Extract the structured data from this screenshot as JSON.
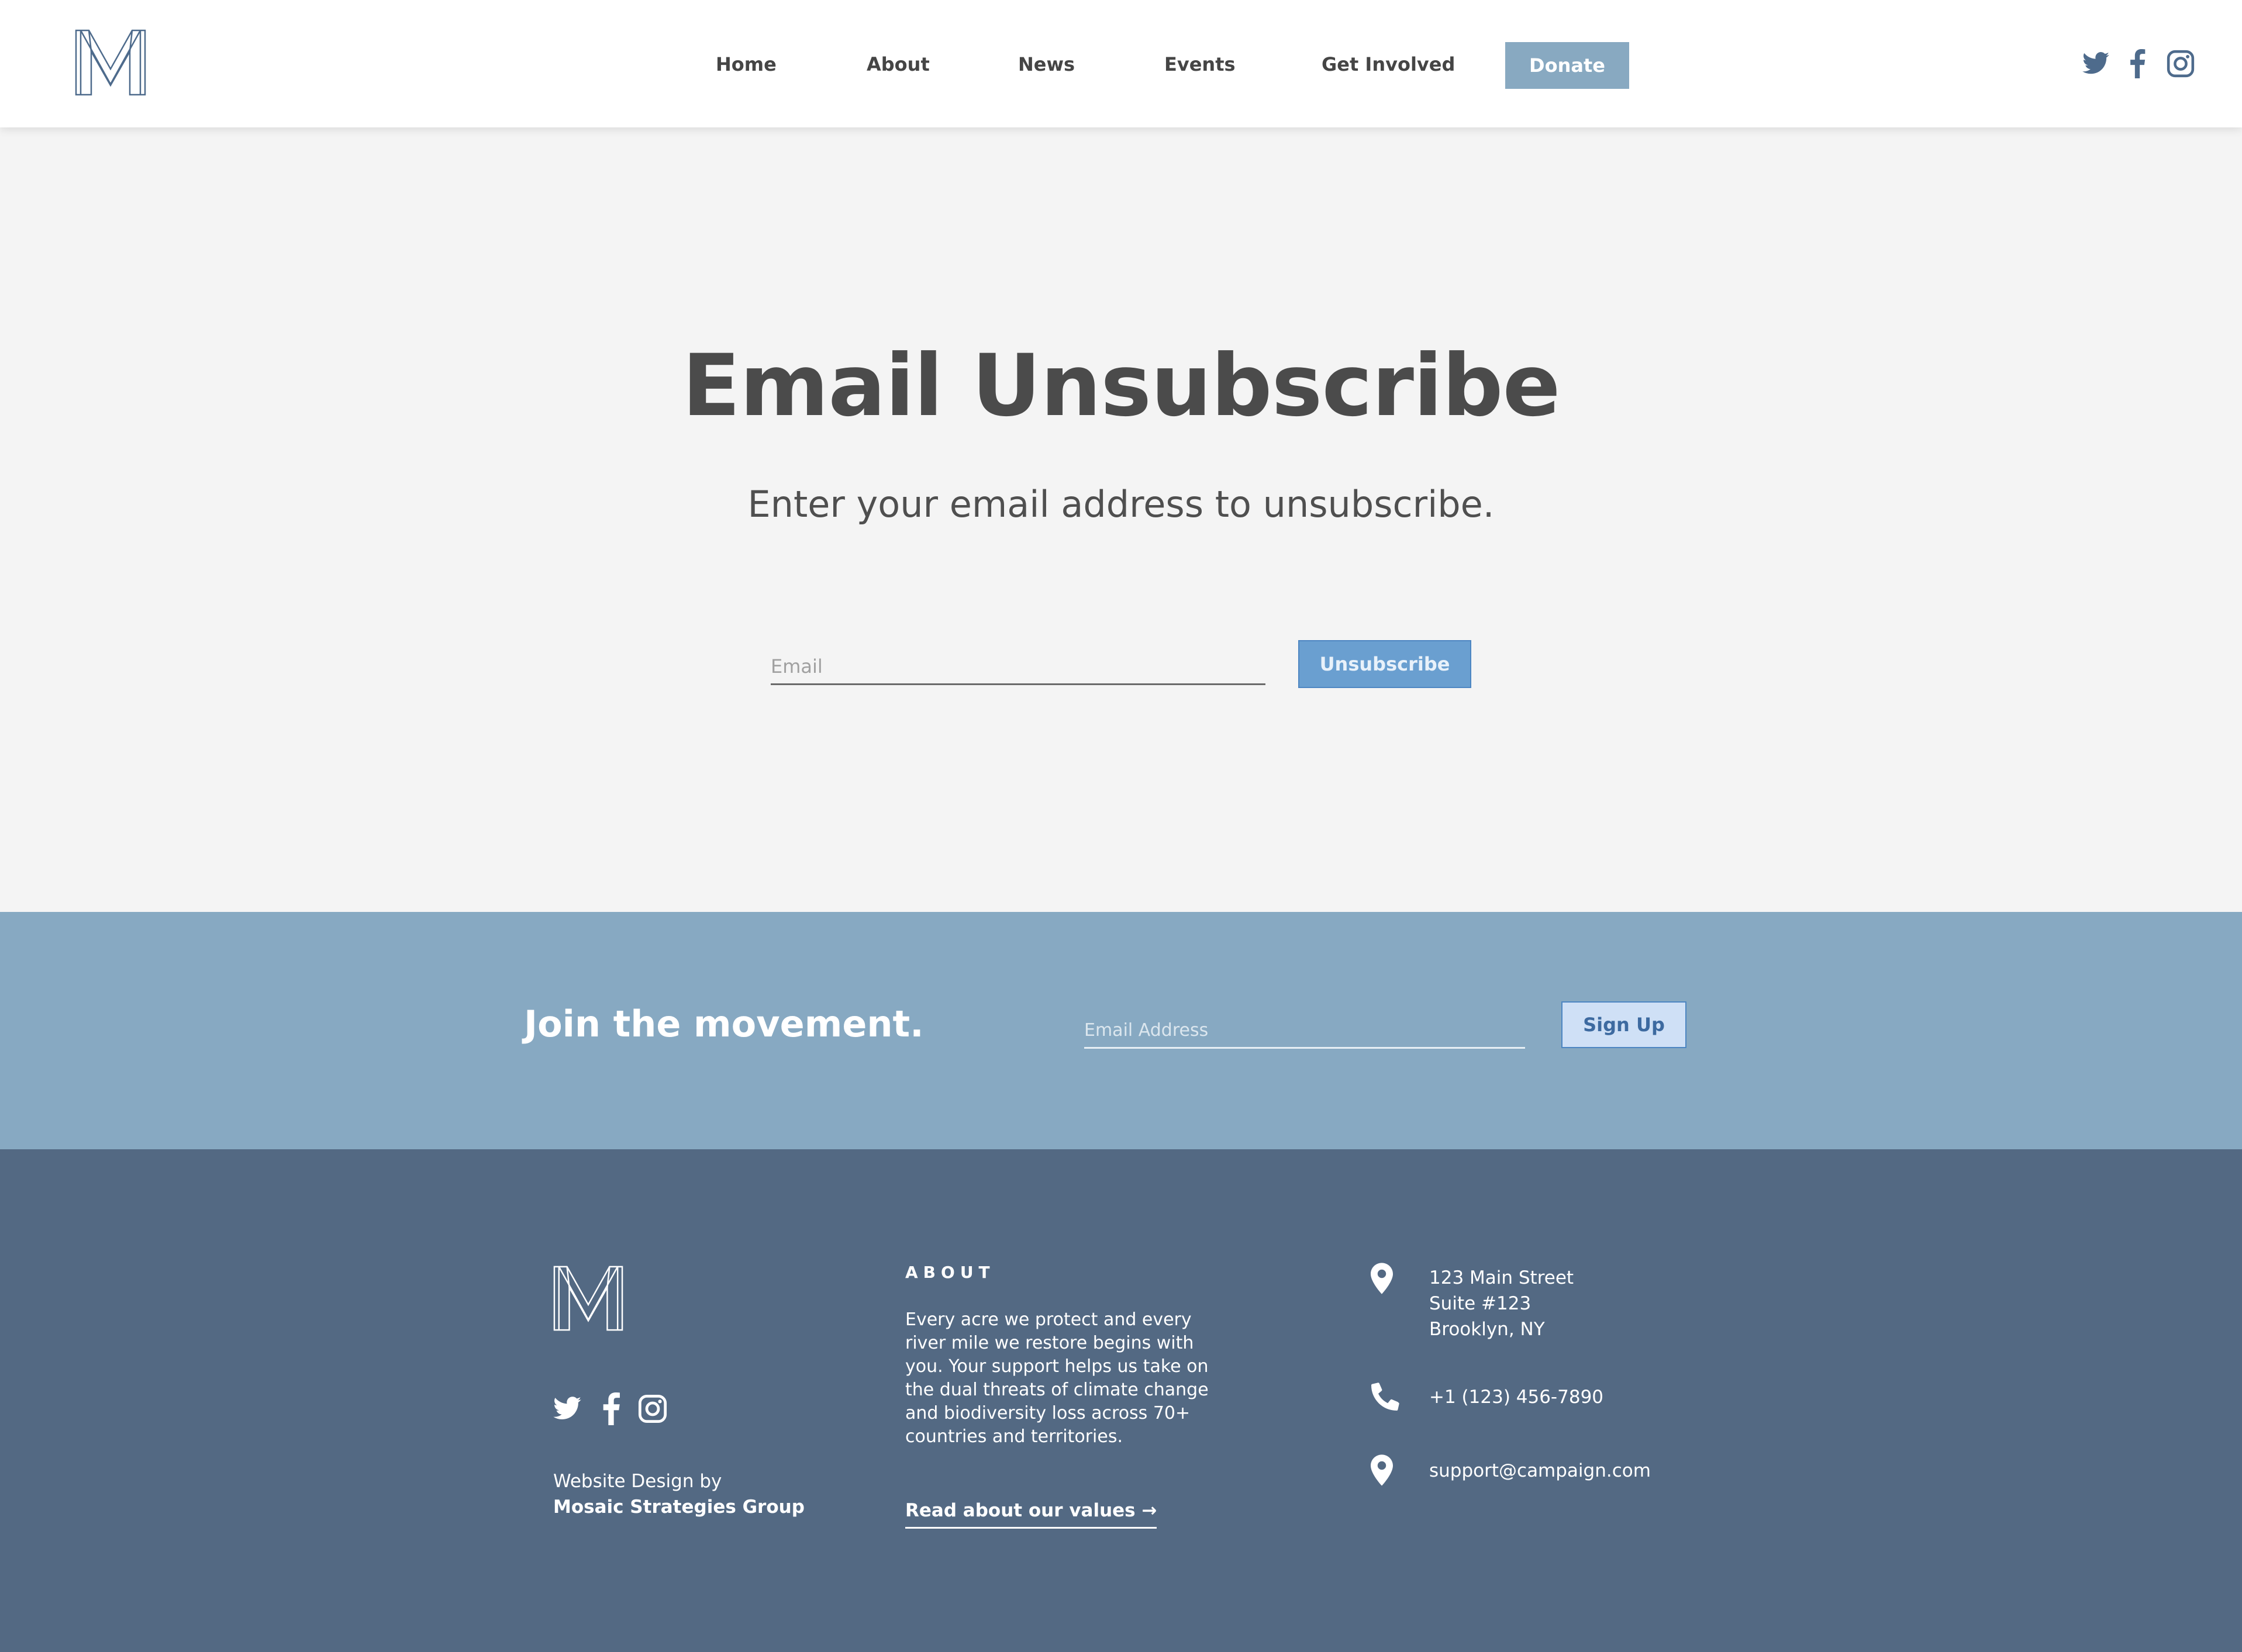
{
  "header": {
    "logo": "M",
    "nav": [
      "Home",
      "About",
      "News",
      "Events",
      "Get Involved"
    ],
    "donate_label": "Donate",
    "social_icons": [
      "twitter-icon",
      "facebook-icon",
      "instagram-icon"
    ]
  },
  "hero": {
    "title": "Email Unsubscribe",
    "subtitle": "Enter your email address to unsubscribe.",
    "email_placeholder": "Email",
    "button_label": "Unsubscribe"
  },
  "join": {
    "title": "Join the movement.",
    "email_placeholder": "Email Address",
    "button_label": "Sign Up"
  },
  "footer": {
    "credit_line1": "Website Design by",
    "credit_line2": "Mosaic Strategies Group",
    "about_heading": "ABOUT",
    "about_text": "Every acre we protect and every river mile we restore begins with you. Your support helps us take on the dual threats of climate change and biodiversity loss across 70+ countries and territories.",
    "about_link": "Read about our values →",
    "address_lines": [
      "123 Main Street",
      "Suite #123",
      "Brooklyn, NY"
    ],
    "phone": "+1 (123) 456-7890",
    "email": "support@campaign.com"
  },
  "colors": {
    "nav_text": "#454545",
    "donate_bg": "#88a9c1",
    "band_bg": "#87a9c2",
    "footer_bg": "#536983",
    "unsubscribe_bg": "#6a9fd0",
    "signup_bg": "#cfe0f6",
    "logo_stroke": "#4e6b8c"
  }
}
